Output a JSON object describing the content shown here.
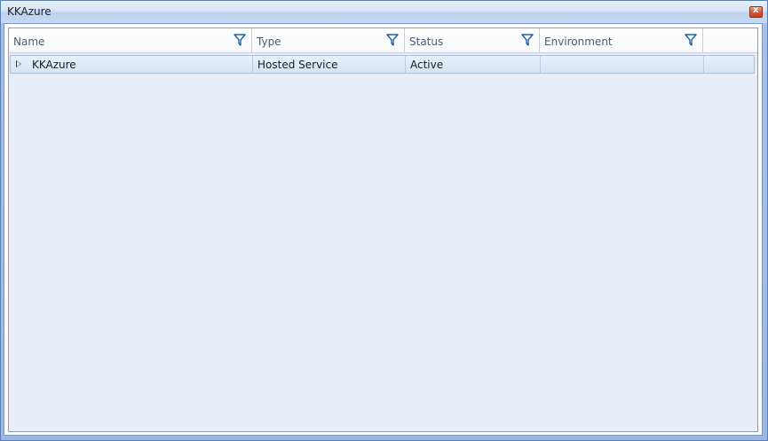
{
  "window": {
    "title": "KKAzure",
    "close_label": "x"
  },
  "grid": {
    "columns": [
      {
        "label": "Name",
        "icon": "filter-icon"
      },
      {
        "label": "Type",
        "icon": "filter-icon"
      },
      {
        "label": "Status",
        "icon": "filter-icon"
      },
      {
        "label": "Environment",
        "icon": "filter-icon"
      }
    ],
    "rows": [
      {
        "name": "KKAzure",
        "type": "Hosted Service",
        "status": "Active",
        "environment": ""
      }
    ]
  },
  "colors": {
    "title_gradient_top": "#eaf1fb",
    "grid_background": "#e9edf8",
    "row_selected": "#d7e4f5",
    "close_button": "#c2401f"
  }
}
